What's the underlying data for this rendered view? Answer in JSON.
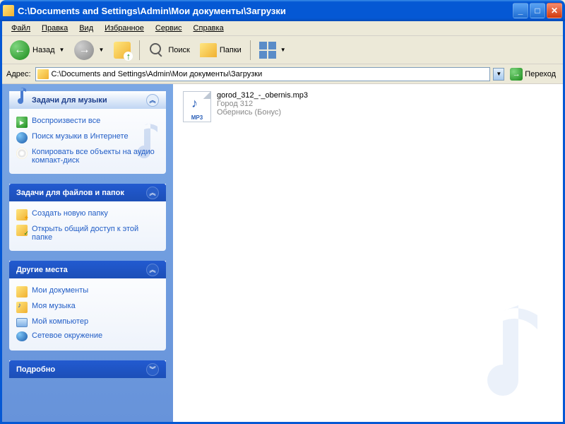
{
  "window": {
    "title": "C:\\Documents and Settings\\Admin\\Мои документы\\Загрузки"
  },
  "menu": {
    "file": "Файл",
    "edit": "Правка",
    "view": "Вид",
    "favorites": "Избранное",
    "tools": "Сервис",
    "help": "Справка"
  },
  "toolbar": {
    "back": "Назад",
    "search": "Поиск",
    "folders": "Папки"
  },
  "addressbar": {
    "label": "Адрес:",
    "path": "C:\\Documents and Settings\\Admin\\Мои документы\\Загрузки",
    "go": "Переход"
  },
  "sidebar": {
    "music": {
      "title": "Задачи для музыки",
      "play_all": "Воспроизвести все",
      "search_web": "Поиск музыки в Интернете",
      "copy_cd": "Копировать все объекты на аудио компакт-диск"
    },
    "filefolder": {
      "title": "Задачи для файлов и папок",
      "new_folder": "Создать новую папку",
      "share": "Открыть общий доступ к этой папке"
    },
    "other": {
      "title": "Другие места",
      "docs": "Мои документы",
      "music": "Моя музыка",
      "computer": "Мой компьютер",
      "network": "Сетевое окружение"
    },
    "details": {
      "title": "Подробно"
    }
  },
  "files": [
    {
      "name": "gorod_312_-_obernis.mp3",
      "artist": "Город 312",
      "title": "Обернись (Бонус)"
    }
  ]
}
